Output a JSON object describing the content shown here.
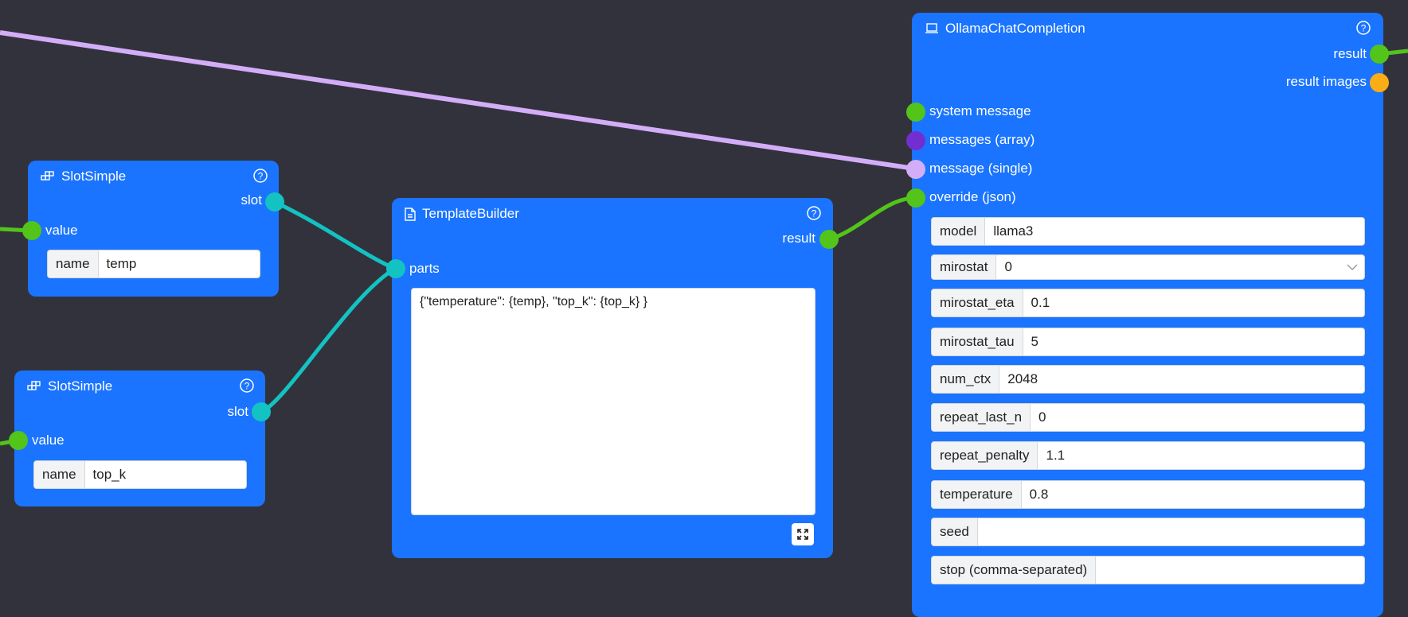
{
  "colors": {
    "canvas": "#32323c",
    "node": "#1a74ff",
    "port_string": "#52c41a",
    "port_slot": "#13c2c2",
    "port_array": "#722ed1",
    "port_message": "#d3adf7",
    "port_image": "#faad14"
  },
  "nodes": {
    "slot1": {
      "title": "SlotSimple",
      "icon": "slot-icon",
      "output_slot": "slot",
      "input_value": "value",
      "name_label": "name",
      "name_value": "temp"
    },
    "slot2": {
      "title": "SlotSimple",
      "icon": "slot-icon",
      "output_slot": "slot",
      "input_value": "value",
      "name_label": "name",
      "name_value": "top_k"
    },
    "template": {
      "title": "TemplateBuilder",
      "icon": "document-icon",
      "output_result": "result",
      "input_parts": "parts",
      "template_text": "{\"temperature\": {temp}, \"top_k\": {top_k} }"
    },
    "ollama": {
      "title": "OllamaChatCompletion",
      "icon": "laptop-icon",
      "outputs": [
        "result",
        "result images"
      ],
      "inputs": [
        "system message",
        "messages (array)",
        "message (single)",
        "override (json)"
      ],
      "params": [
        {
          "label": "model",
          "value": "llama3"
        },
        {
          "label": "mirostat",
          "value": "0"
        },
        {
          "label": "mirostat_eta",
          "value": "0.1"
        },
        {
          "label": "mirostat_tau",
          "value": "5"
        },
        {
          "label": "num_ctx",
          "value": "2048"
        },
        {
          "label": "repeat_last_n",
          "value": "0"
        },
        {
          "label": "repeat_penalty",
          "value": "1.1"
        },
        {
          "label": "temperature",
          "value": "0.8"
        },
        {
          "label": "seed",
          "value": ""
        },
        {
          "label": "stop (comma-separated)",
          "value": ""
        }
      ]
    }
  }
}
